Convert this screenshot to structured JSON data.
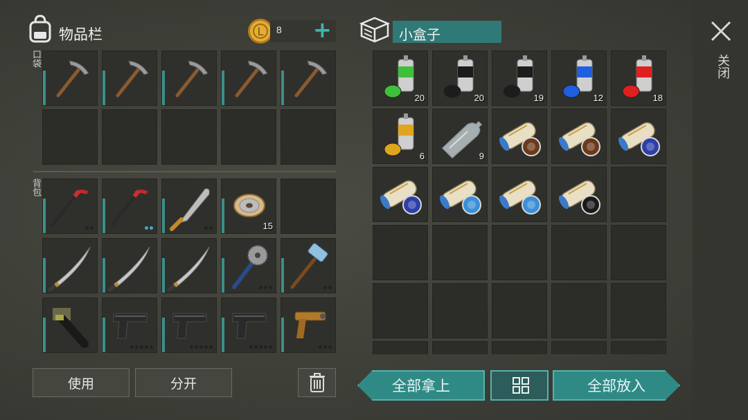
{
  "inventory": {
    "title": "物品栏",
    "coins": "8",
    "add_label": "+",
    "pocket_label": "口袋",
    "backpack_label": "背包",
    "pocket_slots": [
      {
        "item": "pickaxe-icon"
      },
      {
        "item": "pickaxe-icon"
      },
      {
        "item": "pickaxe-icon"
      },
      {
        "item": "pickaxe-icon"
      },
      {
        "item": "pickaxe-icon"
      }
    ],
    "backpack_slots": [
      {
        "item": "crowbar-icon",
        "dots": 2,
        "dots_on": 0
      },
      {
        "item": "crowbar-icon",
        "dots": 2,
        "dots_on": 2
      },
      {
        "item": "machete-icon",
        "dots": 2,
        "dots_on": 0
      },
      {
        "item": "wire-spool-icon",
        "count": "15"
      },
      {
        "item": "empty"
      },
      {
        "item": "katana-icon"
      },
      {
        "item": "katana-icon"
      },
      {
        "item": "katana-icon"
      },
      {
        "item": "saw-mace-icon",
        "dots": 3,
        "dots_on": 0
      },
      {
        "item": "sledgehammer-icon",
        "dots": 2,
        "dots_on": 0
      },
      {
        "item": "grenade-launcher-icon"
      },
      {
        "item": "pistol-icon",
        "dots": 5,
        "dots_on": 0
      },
      {
        "item": "pistol-icon",
        "dots": 5,
        "dots_on": 0
      },
      {
        "item": "pistol-icon",
        "dots": 5,
        "dots_on": 0
      },
      {
        "item": "flare-gun-icon",
        "dots": 3,
        "dots_on": 0
      }
    ],
    "use_label": "使用",
    "split_label": "分开"
  },
  "container": {
    "title": "小盒子",
    "close_label": "关闭",
    "slots": [
      {
        "item": "spray-paint-green-icon",
        "count": "20",
        "color": "#3fbf3a"
      },
      {
        "item": "spray-paint-black-icon",
        "count": "20",
        "color": "#1c1c1c"
      },
      {
        "item": "spray-paint-black-icon",
        "count": "19",
        "color": "#1c1c1c"
      },
      {
        "item": "spray-paint-blue-icon",
        "count": "12",
        "color": "#1f5fe0"
      },
      {
        "item": "spray-paint-red-icon",
        "count": "18",
        "color": "#e01f1f"
      },
      {
        "item": "spray-paint-yellow-icon",
        "count": "6",
        "color": "#e0a51f"
      },
      {
        "item": "plastic-bottle-icon",
        "count": "9"
      },
      {
        "item": "poster-roll-icon",
        "badge": "#6a3a1a"
      },
      {
        "item": "poster-roll-icon",
        "badge": "#6a3a1a"
      },
      {
        "item": "poster-roll-icon",
        "badge": "#2e3fa8"
      },
      {
        "item": "poster-roll-icon",
        "badge": "#2e3fa8"
      },
      {
        "item": "poster-roll-icon",
        "badge": "#3a8fd6"
      },
      {
        "item": "poster-roll-icon",
        "badge": "#3a8fd6"
      },
      {
        "item": "poster-roll-icon",
        "badge": "#1a1a1a"
      }
    ],
    "take_all_label": "全部拿上",
    "put_all_label": "全部放入"
  },
  "colors": {
    "accent": "#2f8a86",
    "slot_bar": "#3b8f8b"
  }
}
